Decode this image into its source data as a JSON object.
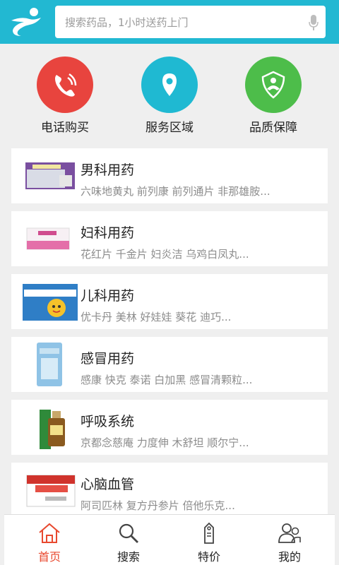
{
  "search": {
    "placeholder": "搜索药品，1小时送药上门"
  },
  "quick_actions": [
    {
      "label": "电话购买",
      "icon": "phone-icon",
      "color": "#e8443e"
    },
    {
      "label": "服务区域",
      "icon": "location-pin-icon",
      "color": "#1fb9d2"
    },
    {
      "label": "品质保障",
      "icon": "quality-badge-icon",
      "color": "#4dbd4a"
    }
  ],
  "categories": [
    {
      "title": "男科用药",
      "subtitle": "六味地黄丸 前列康 前列通片 非那雄胺..."
    },
    {
      "title": "妇科用药",
      "subtitle": "花红片 千金片 妇炎洁 乌鸡白凤丸..."
    },
    {
      "title": "儿科用药",
      "subtitle": "优卡丹 美林 好娃娃 葵花 迪巧..."
    },
    {
      "title": "感冒用药",
      "subtitle": "感康 快克 泰诺 白加黑 感冒清颗粒..."
    },
    {
      "title": "呼吸系统",
      "subtitle": "京都念慈庵 力度伸 木舒坦 顺尔宁..."
    },
    {
      "title": "心脑血管",
      "subtitle": "阿司匹林 复方丹参片 倍他乐克..."
    }
  ],
  "tabs": [
    {
      "label": "首页",
      "icon": "home-icon",
      "active": true
    },
    {
      "label": "搜索",
      "icon": "search-icon",
      "active": false
    },
    {
      "label": "特价",
      "icon": "price-tag-icon",
      "active": false
    },
    {
      "label": "我的",
      "icon": "user-icon",
      "active": false
    }
  ],
  "colors": {
    "header": "#22b8d2",
    "active_tab": "#e8492f",
    "background": "#efefef"
  }
}
